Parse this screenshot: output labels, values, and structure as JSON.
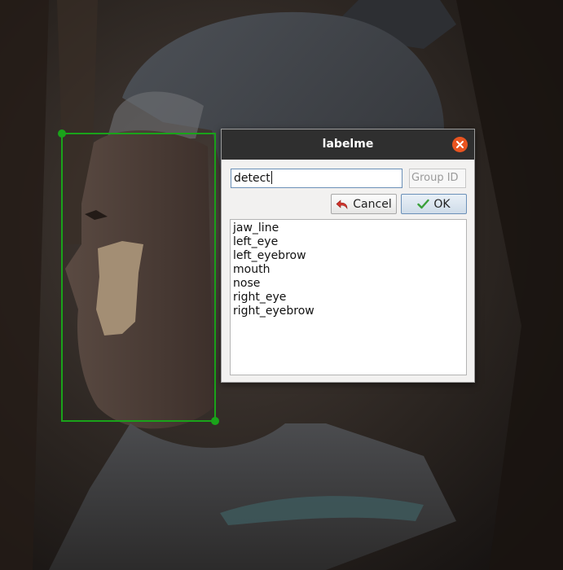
{
  "dialog": {
    "title": "labelme",
    "label_value": "detect",
    "group_id_placeholder": "Group ID",
    "cancel_label": "Cancel",
    "ok_label": "OK",
    "labels": [
      "jaw_line",
      "left_eye",
      "left_eyebrow",
      "mouth",
      "nose",
      "right_eye",
      "right_eyebrow"
    ]
  },
  "icons": {
    "close": "close-icon",
    "cancel": "undo-arrow-icon",
    "ok": "checkmark-icon"
  },
  "colors": {
    "bbox": "#1aa31a",
    "titlebar": "#2f2f2f",
    "close_button": "#e95420",
    "ok_check": "#3aa03a",
    "cancel_arrow": "#d0342c"
  }
}
